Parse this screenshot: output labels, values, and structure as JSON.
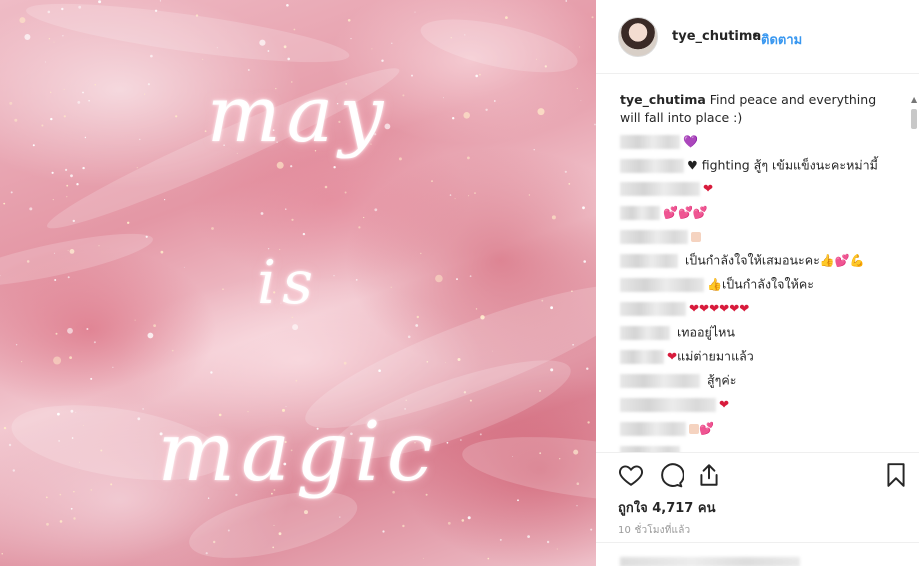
{
  "post": {
    "image_text": {
      "line1": "may",
      "line2": "is",
      "line3": "magic"
    }
  },
  "header": {
    "username": "tye_chutima",
    "separator": "•",
    "follow_label": "ติดตาม"
  },
  "caption": {
    "username": "tye_chutima",
    "text": "Find peace and everything will fall into place :)"
  },
  "comments": [
    {
      "text": "",
      "emoji": "💜"
    },
    {
      "text": "fighting สู้ๆ เข้มแข็งนะคะหม่ามี้",
      "emoji": "♥"
    },
    {
      "text": "",
      "emoji": "❤"
    },
    {
      "text": "",
      "emoji": "💕💕💕"
    },
    {
      "text": "",
      "emoji": ""
    },
    {
      "text": "เป็นกำลังใจให้เสมอนะคะ",
      "emoji": "👍💕💪"
    },
    {
      "text": "เป็นกำลังใจให้คะ",
      "emoji": "👍"
    },
    {
      "text": "",
      "emoji": "❤❤❤❤❤❤"
    },
    {
      "text": "เทออยู่ไหน",
      "emoji": ""
    },
    {
      "text": "แม่ต่ายมาแล้ว",
      "emoji": "❤"
    },
    {
      "text": "สู้ๆค่ะ",
      "emoji": ""
    },
    {
      "text": "",
      "emoji": "❤"
    },
    {
      "text": "",
      "emoji": "💕"
    }
  ],
  "actions": {
    "likes_label": "ถูกใจ 4,717 คน",
    "timestamp": "10 ชั่วโมงที่แล้ว"
  },
  "colors": {
    "link_blue": "#3897f0",
    "text": "#262626",
    "heart_red": "#d81b3c",
    "divider": "#efefef"
  },
  "icons": [
    "heart-icon",
    "comment-icon",
    "share-icon",
    "bookmark-icon"
  ]
}
